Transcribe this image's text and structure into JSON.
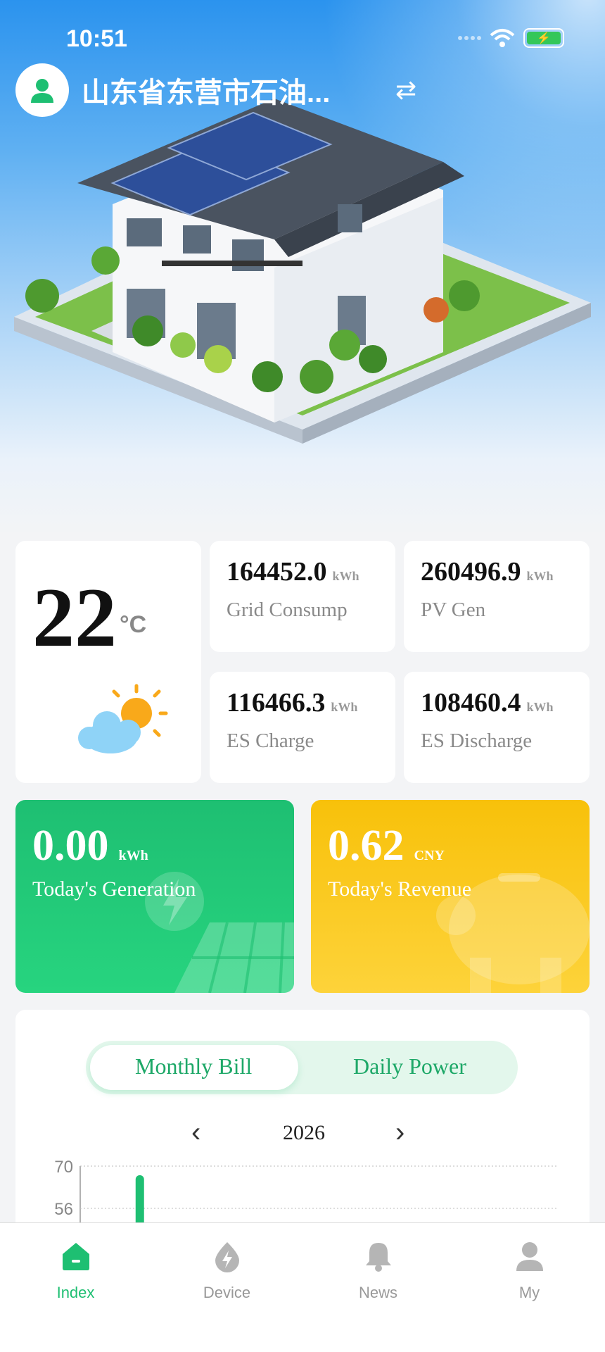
{
  "status_bar": {
    "time": "10:51"
  },
  "header": {
    "location": "山东省东营市石油..."
  },
  "weather": {
    "temperature": "22",
    "unit": "°C",
    "icon": "partly-cloudy-icon"
  },
  "stats": [
    {
      "value": "164452.0",
      "unit": "kWh",
      "label": "Grid Consump"
    },
    {
      "value": "260496.9",
      "unit": "kWh",
      "label": "PV Gen"
    },
    {
      "value": "116466.3",
      "unit": "kWh",
      "label": "ES Charge"
    },
    {
      "value": "108460.4",
      "unit": "kWh",
      "label": "ES Discharge"
    }
  ],
  "today_generation": {
    "value": "0.00",
    "unit": "kWh",
    "label": "Today's Generation"
  },
  "today_revenue": {
    "value": "0.62",
    "unit": "CNY",
    "label": "Today's Revenue"
  },
  "chart_section": {
    "tabs": [
      {
        "label": "Monthly Bill",
        "active": true
      },
      {
        "label": "Daily Power",
        "active": false
      }
    ],
    "year": "2026"
  },
  "chart_data": {
    "type": "bar",
    "y_ticks": [
      "70",
      "56"
    ],
    "visible_ymin": 56,
    "ymax": 70,
    "bars": [
      {
        "index": 2,
        "value": 67
      }
    ],
    "grid": true
  },
  "tabbar": [
    {
      "label": "Index",
      "icon": "home-icon",
      "active": true
    },
    {
      "label": "Device",
      "icon": "lightning-drop-icon",
      "active": false
    },
    {
      "label": "News",
      "icon": "bell-icon",
      "active": false
    },
    {
      "label": "My",
      "icon": "user-icon",
      "active": false
    }
  ],
  "colors": {
    "accent_green": "#1ebf72",
    "accent_yellow": "#f9c712"
  }
}
